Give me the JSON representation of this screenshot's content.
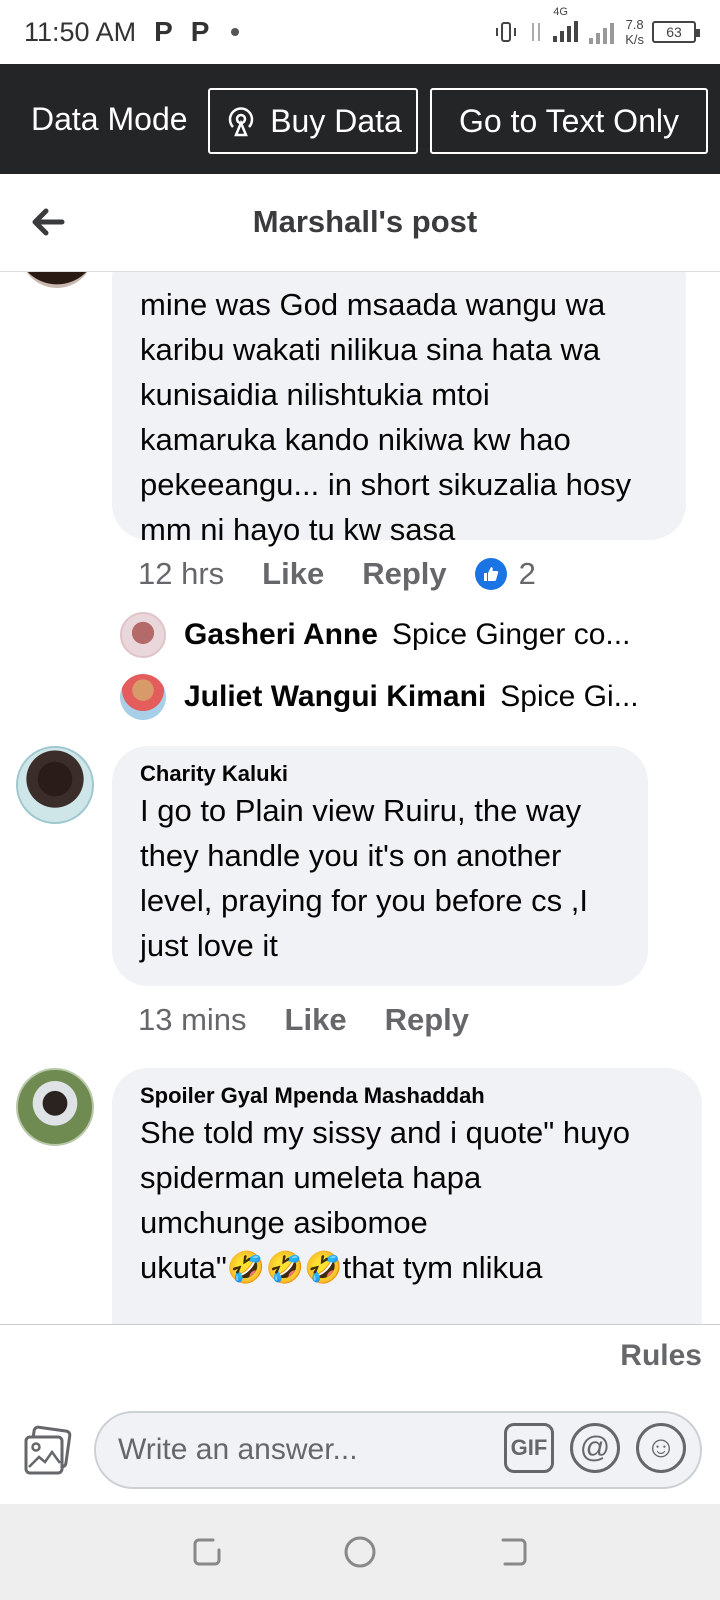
{
  "status_bar": {
    "time": "11:50 AM",
    "app_icons": [
      "P",
      "P"
    ],
    "network": "4G",
    "speed_value": "7.8",
    "speed_unit": "K/s",
    "battery": "63"
  },
  "data_bar": {
    "label": "Data Mode",
    "buy_data": "Buy Data",
    "text_only": "Go to Text Only"
  },
  "header": {
    "title": "Marshall's post"
  },
  "comments": {
    "first": {
      "text_lines": [
        "mine was God msaada wangu  wa",
        "karibu wakati nilikua sina hata wa",
        "kunisaidia nilishtukia mtoi",
        "kamaruka kando nikiwa kw hao",
        "pekeeangu... in short sikuzalia hosy",
        "mm ni hayo tu kw sasa"
      ],
      "time": "12 hrs",
      "like": "Like",
      "reply": "Reply",
      "reaction_count": "2",
      "replies": [
        {
          "name": "Gasheri Anne",
          "snippet": "Spice Ginger co..."
        },
        {
          "name": "Juliet Wangui Kimani",
          "snippet": "Spice Gi..."
        }
      ]
    },
    "second": {
      "author": "Charity Kaluki",
      "text_lines": [
        "I go to Plain view Ruiru, the way",
        "they handle you it's on another",
        "level, praying for you before cs ,I",
        "just love it"
      ],
      "time": "13 mins",
      "like": "Like",
      "reply": "Reply"
    },
    "third": {
      "author": "Spoiler Gyal Mpenda Mashaddah",
      "text_lines": [
        "She told my sissy and i  quote\" huyo",
        "spiderman umeleta hapa",
        "umchunge asibomoe",
        "ukuta\"🤣🤣🤣that tym nlikua"
      ]
    }
  },
  "composer": {
    "rules": "Rules",
    "placeholder": "Write an answer...",
    "gif": "GIF",
    "mention": "@",
    "emoji": "☺"
  },
  "colors": {
    "brand_blue": "#1b74e4",
    "dark_bar": "#242526",
    "bubble": "#f0f2f5",
    "secondary_text": "#65676b"
  }
}
